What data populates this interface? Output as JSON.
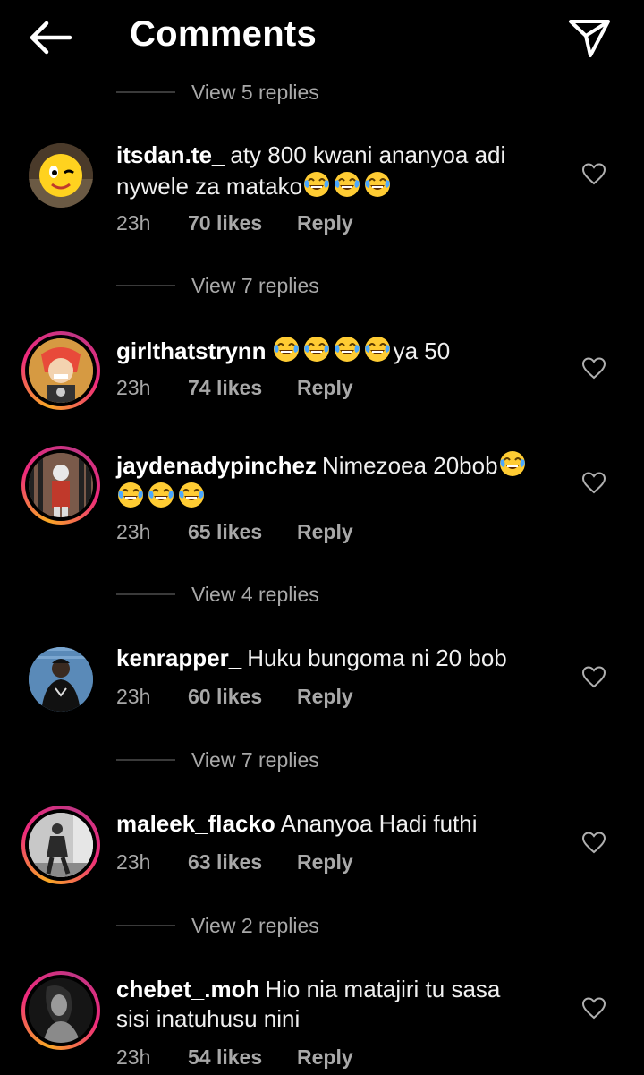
{
  "header": {
    "title": "Comments"
  },
  "replies_top": "View 5 replies",
  "comments": [
    {
      "username": "itsdan.te_",
      "text_a": "aty 800 kwani ananyoa adi",
      "text_b": "nywele za matako",
      "time": "23h",
      "likes": "70 likes",
      "reply": "Reply",
      "view_replies": "View 7 replies"
    },
    {
      "username": "girlthatstrynn",
      "text_a": "ya 50",
      "time": "23h",
      "likes": "74 likes",
      "reply": "Reply"
    },
    {
      "username": "jaydenadypinchez",
      "text_a": "Nimezoea 20bob",
      "time": "23h",
      "likes": "65 likes",
      "reply": "Reply",
      "view_replies": "View 4 replies"
    },
    {
      "username": "kenrapper_",
      "text_a": "Huku bungoma ni 20 bob",
      "time": "23h",
      "likes": "60 likes",
      "reply": "Reply",
      "view_replies": "View 7 replies"
    },
    {
      "username": "maleek_flacko",
      "text_a": "Ananyoa Hadi futhi",
      "time": "23h",
      "likes": "63 likes",
      "reply": "Reply",
      "view_replies": "View 2 replies"
    },
    {
      "username": "chebet_.moh",
      "text_a": "Hio nia matajiri tu sasa",
      "text_b": "sisi inatuhusu nini",
      "time": "23h",
      "likes": "54 likes",
      "reply": "Reply"
    }
  ],
  "icons": {
    "back": "arrow-left-icon",
    "share": "paper-plane-icon",
    "like": "heart-outline-icon",
    "emoji": "laughing-tears-emoji"
  },
  "colors": {
    "background": "#000000",
    "secondary_text": "#a8a8a8",
    "story_ring_start": "#f9a825",
    "story_ring_end": "#ee2a7b"
  }
}
